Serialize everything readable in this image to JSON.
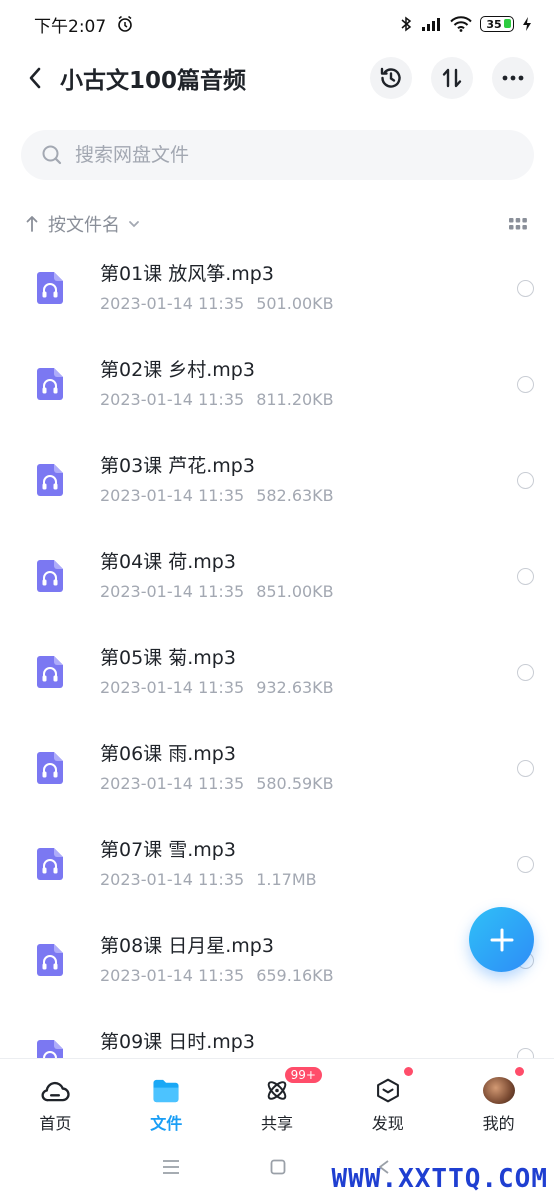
{
  "status_bar": {
    "time": "下午2:07",
    "battery": "35"
  },
  "header": {
    "title": "小古文100篇音频"
  },
  "search": {
    "placeholder": "搜索网盘文件"
  },
  "sort": {
    "label": "按文件名"
  },
  "files": [
    {
      "name": "第01课 放风筝.mp3",
      "date": "2023-01-14 11:35",
      "size": "501.00KB"
    },
    {
      "name": "第02课 乡村.mp3",
      "date": "2023-01-14 11:35",
      "size": "811.20KB"
    },
    {
      "name": "第03课 芦花.mp3",
      "date": "2023-01-14 11:35",
      "size": "582.63KB"
    },
    {
      "name": "第04课 荷.mp3",
      "date": "2023-01-14 11:35",
      "size": "851.00KB"
    },
    {
      "name": "第05课 菊.mp3",
      "date": "2023-01-14 11:35",
      "size": "932.63KB"
    },
    {
      "name": "第06课 雨.mp3",
      "date": "2023-01-14 11:35",
      "size": "580.59KB"
    },
    {
      "name": "第07课 雪.mp3",
      "date": "2023-01-14 11:35",
      "size": "1.17MB"
    },
    {
      "name": "第08课 日月星.mp3",
      "date": "2023-01-14 11:35",
      "size": "659.16KB"
    },
    {
      "name": "第09课 日时.mp3",
      "date": "",
      "size": ""
    }
  ],
  "bottom_nav": [
    {
      "label": "首页"
    },
    {
      "label": "文件"
    },
    {
      "label": "共享",
      "badge": "99+"
    },
    {
      "label": "发现"
    },
    {
      "label": "我的"
    }
  ],
  "watermark": "WWW.XXTTQ.COM",
  "colors": {
    "accent": "#1a9ef5",
    "file_icon": "#7b78f2",
    "badge": "#ff4d6a"
  }
}
